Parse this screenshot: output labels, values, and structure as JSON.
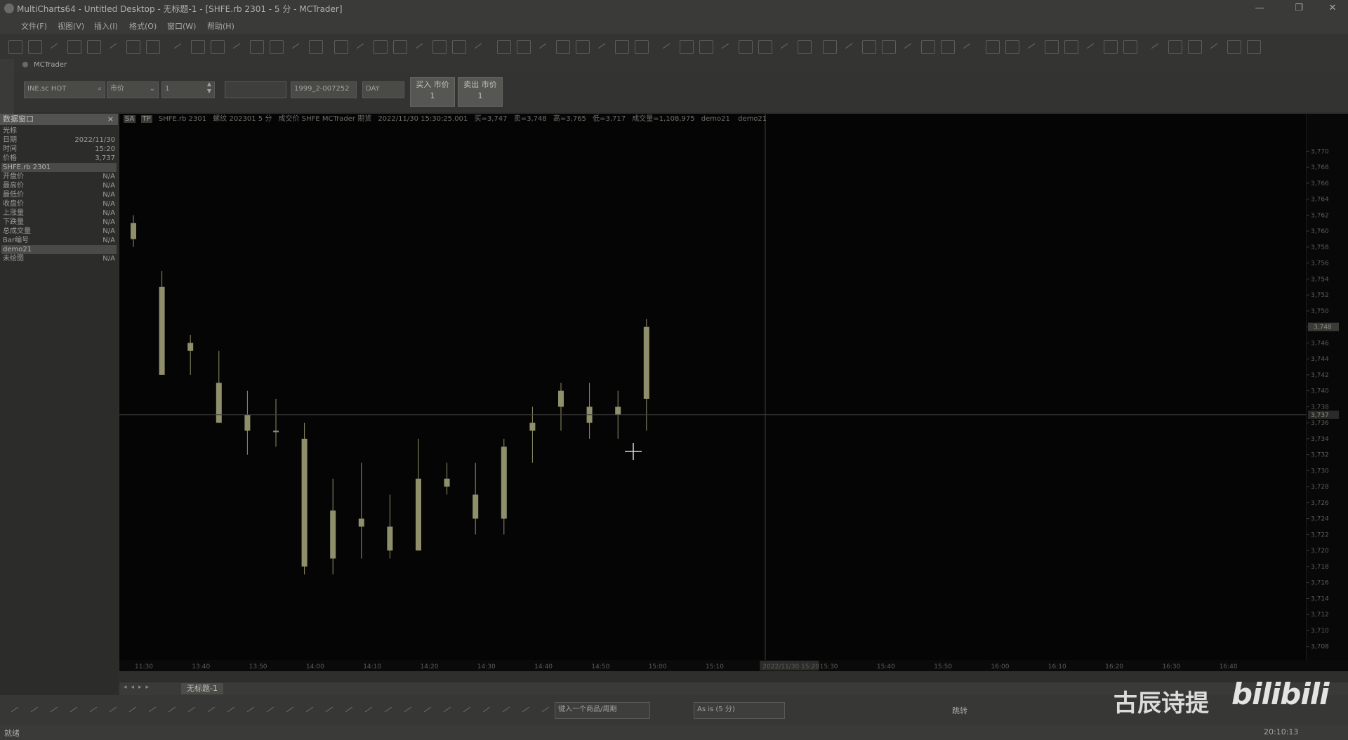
{
  "window": {
    "title": "MultiCharts64 - Untitled Desktop - 无标题-1 - [SHFE.rb 2301 - 5 分 - MCTrader]",
    "minimize": "—",
    "maximize": "❐",
    "close": "✕"
  },
  "menu": {
    "items": [
      "文件(F)",
      "视图(V)",
      "插入(I)",
      "格式(O)",
      "窗口(W)",
      "帮助(H)"
    ]
  },
  "trade_panel": {
    "tab": "MCTrader",
    "symbol": "INE.sc HOT",
    "price_type": "市价",
    "quantity": "1",
    "account": "1999_2-007252",
    "duration": "DAY",
    "buy_label": "买入 市价",
    "buy_qty": "1",
    "sell_label": "卖出 市价",
    "sell_qty": "1"
  },
  "data_window": {
    "title": "数据窗口",
    "close": "×",
    "rows_top": [
      {
        "label": "光标",
        "value": ""
      },
      {
        "label": "日期",
        "value": "2022/11/30"
      },
      {
        "label": "时间",
        "value": "15:20"
      },
      {
        "label": "价格",
        "value": "3,737"
      }
    ],
    "section1": "SHFE.rb 2301",
    "rows_mid": [
      {
        "label": "开盘价",
        "value": "N/A"
      },
      {
        "label": "最高价",
        "value": "N/A"
      },
      {
        "label": "最低价",
        "value": "N/A"
      },
      {
        "label": "收盘价",
        "value": "N/A"
      },
      {
        "label": "上涨量",
        "value": "N/A"
      },
      {
        "label": "下跌量",
        "value": "N/A"
      },
      {
        "label": "总成交量",
        "value": "N/A"
      },
      {
        "label": "Bar编号",
        "value": "N/A"
      }
    ],
    "section2": "demo21",
    "rows_bottom": [
      {
        "label": "未绘图",
        "value": "N/A"
      }
    ]
  },
  "chart_status": {
    "mode_a": "SA",
    "mode_b": "TP",
    "symbol": "SHFE.rb 2301",
    "desc": "螺纹 202301 5 分",
    "feed": "成交价 SHFE MCTrader 期货",
    "datetime": "2022/11/30 15:30:25.001",
    "bid": "买=3,747",
    "ask": "卖=3,748",
    "high": "高=3,765",
    "low": "低=3,717",
    "volume": "成交量=1,108,975",
    "study": "demo21",
    "study2": "demo21"
  },
  "chart_data": {
    "type": "candlestick",
    "x": [
      "11:30",
      "13:35",
      "13:40",
      "13:45",
      "13:50",
      "13:55",
      "14:00",
      "14:05",
      "14:10",
      "14:15",
      "14:20",
      "14:25",
      "14:30",
      "14:35",
      "14:40",
      "14:45",
      "14:50",
      "14:55",
      "15:00"
    ],
    "open": [
      3761,
      3753,
      3745,
      3741,
      3737,
      3735,
      3734,
      3725,
      3724,
      3723,
      3720,
      3729,
      3724,
      3733,
      3736,
      3740,
      3736,
      3738,
      3739
    ],
    "high": [
      3762,
      3755,
      3747,
      3745,
      3740,
      3739,
      3736,
      3729,
      3731,
      3727,
      3734,
      3731,
      3731,
      3734,
      3738,
      3741,
      3741,
      3740,
      3749
    ],
    "low": [
      3758,
      3742,
      3742,
      3736,
      3732,
      3733,
      3717,
      3717,
      3719,
      3719,
      3720,
      3727,
      3722,
      3722,
      3731,
      3735,
      3734,
      3734,
      3735
    ],
    "close": [
      3759,
      3742,
      3746,
      3736,
      3735,
      3735,
      3718,
      3719,
      3723,
      3720,
      3729,
      3728,
      3727,
      3724,
      3735,
      3738,
      3738,
      3737,
      3748
    ],
    "ylim": [
      3707,
      3771
    ],
    "y_ticks": [
      "3,770",
      "3,768",
      "3,766",
      "3,764",
      "3,762",
      "3,760",
      "3,758",
      "3,756",
      "3,754",
      "3,752",
      "3,750",
      "3,748",
      "3,746",
      "3,744",
      "3,742",
      "3,740",
      "3,738",
      "3,736",
      "3,734",
      "3,732",
      "3,730",
      "3,728",
      "3,726",
      "3,724",
      "3,722",
      "3,720",
      "3,718",
      "3,716",
      "3,714",
      "3,712",
      "3,710",
      "3,708"
    ],
    "x_ticks": [
      "11:30",
      "13:40",
      "13:50",
      "14:00",
      "14:10",
      "14:20",
      "14:30",
      "14:40",
      "14:50",
      "15:00",
      "15:10",
      "2022/11/30 15:20",
      "15:30",
      "15:40",
      "15:50",
      "16:00",
      "16:10",
      "16:20",
      "16:30",
      "16:40"
    ],
    "crosshair_price": "3,737",
    "last_price": "3,748",
    "candle_color": "#8f8f6c"
  },
  "sheet_tab": "无标题-1",
  "drawing_bar": {
    "symbol_input": "键入一个商品/周期",
    "interval": "As is (5 分)",
    "goto": "跳转"
  },
  "statusbar": {
    "left": "就绪",
    "time": "20:10:13"
  },
  "watermark": {
    "text": "古辰诗提",
    "brand": "bilibili"
  }
}
